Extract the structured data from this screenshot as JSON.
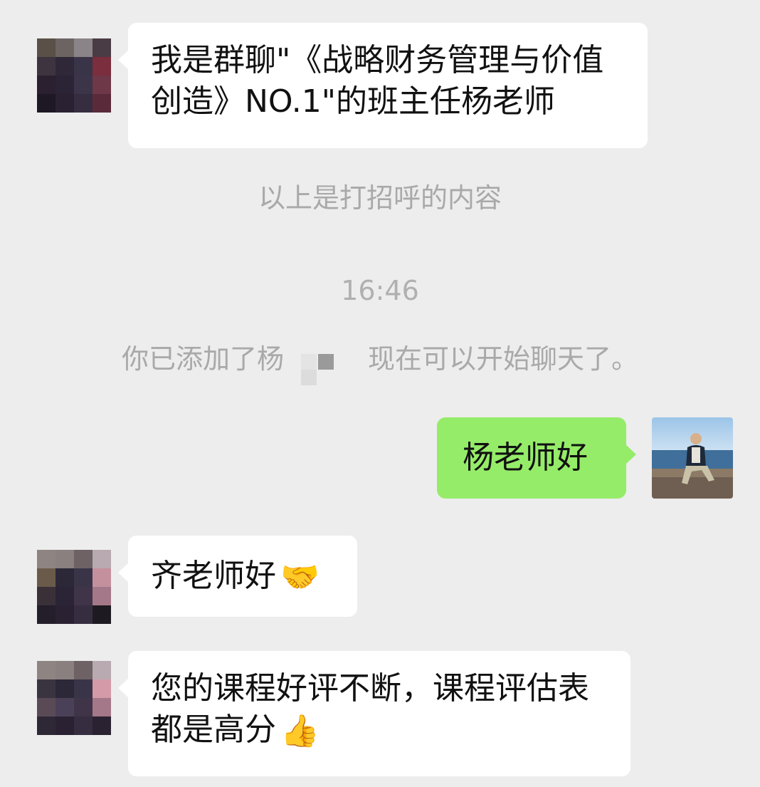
{
  "messages": [
    {
      "side": "left",
      "text": "我是群聊\"《战略财务管理与价值创造》NO.1\"的班主任杨老师"
    },
    {
      "side": "left",
      "text": "齐老师好",
      "emoji": "🤝",
      "emoji_name": "handshake-icon"
    },
    {
      "side": "left",
      "text": "您的课程好评不断，课程评估表都是高分",
      "emoji": "👍",
      "emoji_name": "thumbs-up-icon"
    }
  ],
  "system": {
    "greeting_note": "以上是打招呼的内容",
    "time": "16:46",
    "added_prefix": "你已添加了杨",
    "added_suffix": "现在可以开始聊天了。"
  },
  "my_message": {
    "side": "right",
    "text": "杨老师好"
  },
  "colors": {
    "background": "#ededed",
    "bubble_incoming": "#ffffff",
    "bubble_outgoing": "#95ec69",
    "system_text": "#a9a9a9"
  }
}
